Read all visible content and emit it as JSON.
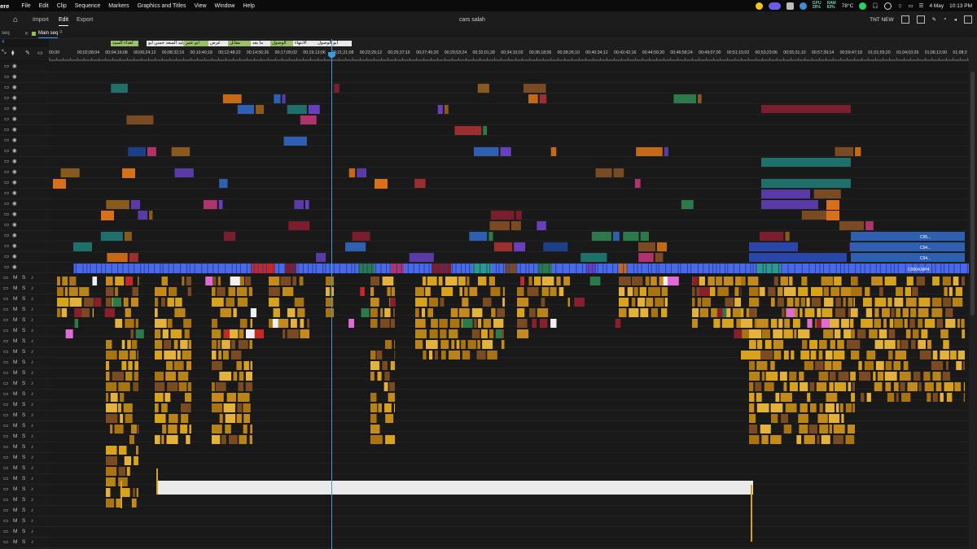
{
  "menubar": {
    "app_name": "iere",
    "items": [
      "File",
      "Edit",
      "Clip",
      "Sequence",
      "Markers",
      "Graphics and Titles",
      "View",
      "Window",
      "Help"
    ],
    "status": {
      "gpu_label": "GPU",
      "gpu_value": "28%",
      "ram_label": "RAM",
      "ram_value": "83%",
      "temp": "78°C",
      "date": "4 May",
      "time": "10:13 PM"
    }
  },
  "workspace": {
    "tabs": [
      "Import",
      "Edit",
      "Export"
    ],
    "active_tab": "Edit",
    "project_title": "cars salah",
    "right_label": "TNT NEW"
  },
  "sequence": {
    "side_label": "seq",
    "name": "Main seq",
    "timecode_fragment": "4"
  },
  "ruler": {
    "timecodes": [
      "00;00",
      "00;02;08;04",
      "00;04;16;08",
      "00;06;24;12",
      "00;08;32;16",
      "00;10;40;18",
      "00;12;48;22",
      "00;14;56;26",
      "00;17;05;02",
      "00;19;13;06",
      "00;21;21;08",
      "00;23;29;12",
      "00;25;37;16",
      "00;27;45;20",
      "00;29;53;24",
      "00;32;01;28",
      "00;34;10;02",
      "00;36;18;06",
      "00;38;26;10",
      "00;40;34;12",
      "00;42;42;16",
      "00;44;50;20",
      "00;46;58;24",
      "00;49;07;00",
      "00;51;15;02",
      "00;53;23;06",
      "00;55;31;10",
      "00;57;39;14",
      "00;59;47;18",
      "01;01;55;20",
      "01;04;03;26",
      "01;06;12;00",
      "01;08;2"
    ],
    "markers": [
      "اهداء السيد",
      "وليد السعد حسن ابو",
      "ابو عمر",
      "عرض",
      "مقابل",
      "ما بعد",
      "الوصول",
      "الانتهاء",
      "ابو الوصول"
    ]
  },
  "clip_labels": [
    "C95...",
    "C94...",
    "C94...",
    "C0004.MP4"
  ],
  "colors": {
    "playhead": "#3b9bd6",
    "v1_blue": "#4a69e8",
    "audio_gold": "#d9a21b",
    "accent_tab": "#4d8fe8"
  }
}
